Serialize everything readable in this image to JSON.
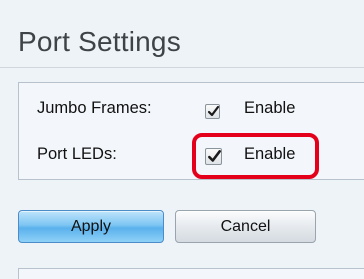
{
  "page": {
    "title": "Port Settings"
  },
  "settings": {
    "jumbo_frames": {
      "label": "Jumbo Frames:",
      "checked": true,
      "option_label": "Enable"
    },
    "port_leds": {
      "label": "Port LEDs:",
      "checked": true,
      "option_label": "Enable",
      "highlighted": true
    }
  },
  "actions": {
    "apply_label": "Apply",
    "cancel_label": "Cancel"
  },
  "colors": {
    "highlight": "#e4001b",
    "apply_button": "#7ec6f3",
    "background": "#eef3f8"
  },
  "icons": {
    "checkmark": "checkmark-icon"
  }
}
